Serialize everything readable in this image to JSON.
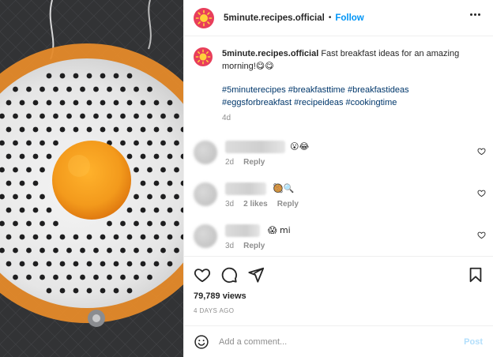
{
  "header": {
    "username": "5minute.recipes.official",
    "separator": "•",
    "follow_label": "Follow",
    "more_icon": "more-horizontal-icon"
  },
  "caption": {
    "username": "5minute.recipes.official",
    "text": "Fast breakfast ideas for an amazing morning!",
    "emojis": "😋😋",
    "hashtags_line1": "#5minuterecipes #breakfasttime #breakfastideas",
    "hashtags_line2": "#eggsforbreakfast #recipeideas #cookingtime",
    "age": "4d"
  },
  "comments": [
    {
      "text": "😮😂",
      "age": "2d",
      "likes": "",
      "reply": "Reply"
    },
    {
      "text": "🥘🔍",
      "age": "3d",
      "likes": "2 likes",
      "reply": "Reply"
    },
    {
      "text": "😱 mi",
      "age": "3d",
      "likes": "",
      "reply": "Reply"
    }
  ],
  "stats": {
    "views": "79,789 views",
    "date": "4 DAYS AGO"
  },
  "composer": {
    "placeholder": "Add a comment...",
    "post_label": "Post"
  },
  "colors": {
    "accent": "#0095f6",
    "hashtag": "#00376b",
    "muted": "#8e8e8e",
    "post_disabled": "#b2dffc",
    "avatar_bg": "#e83e5b",
    "yolk": "#f39a1c",
    "ring": "#e58a2a"
  }
}
